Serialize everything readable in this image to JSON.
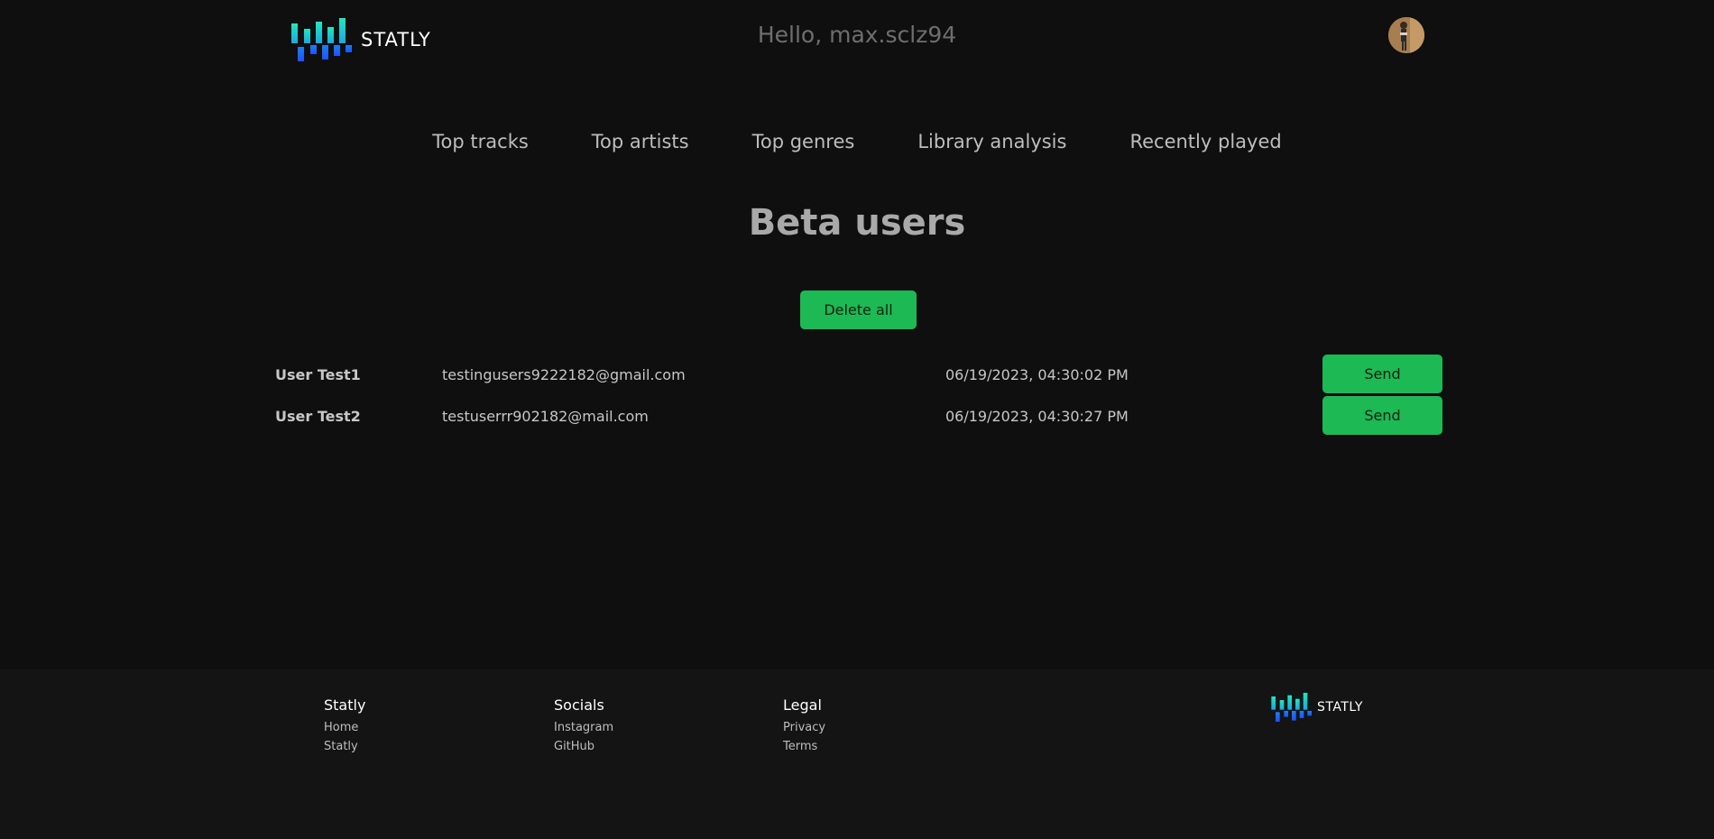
{
  "brand": {
    "name": "STATLY",
    "colors": {
      "accent": "#1db954",
      "logo_top": "#1ee0c0",
      "logo_bottom": "#2060ff"
    }
  },
  "header": {
    "greeting": "Hello, max.sclz94",
    "avatar_icon": "user-avatar"
  },
  "nav": {
    "items": [
      {
        "label": "Top tracks"
      },
      {
        "label": "Top artists"
      },
      {
        "label": "Top genres"
      },
      {
        "label": "Library analysis"
      },
      {
        "label": "Recently played"
      }
    ]
  },
  "main": {
    "title": "Beta users",
    "delete_all_label": "Delete all",
    "users": [
      {
        "name": "User Test1",
        "email": "testingusers9222182@gmail.com",
        "date": "06/19/2023, 04:30:02 PM",
        "action": "Send"
      },
      {
        "name": "User Test2",
        "email": "testuserrr902182@mail.com",
        "date": "06/19/2023, 04:30:27 PM",
        "action": "Send"
      }
    ]
  },
  "footer": {
    "columns": [
      {
        "heading": "Statly",
        "links": [
          "Home",
          "Statly"
        ]
      },
      {
        "heading": "Socials",
        "links": [
          "Instagram",
          "GitHub"
        ]
      },
      {
        "heading": "Legal",
        "links": [
          "Privacy",
          "Terms"
        ]
      }
    ],
    "logo_text": "STATLY"
  }
}
